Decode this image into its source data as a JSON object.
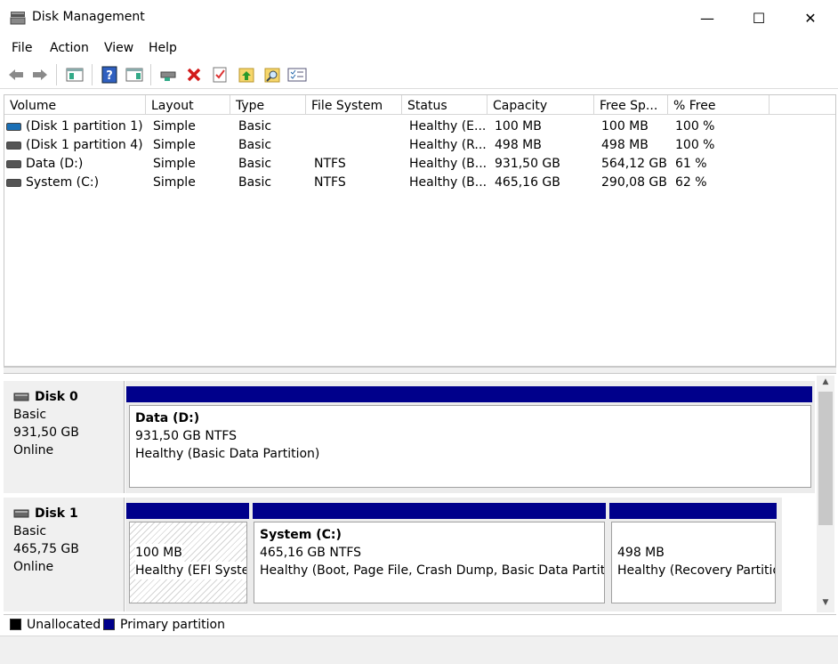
{
  "window": {
    "title": "Disk Management",
    "minimize": "—",
    "maximize": "☐",
    "close": "✕"
  },
  "menu": [
    "File",
    "Action",
    "View",
    "Help"
  ],
  "toolbar": {
    "icons": [
      "back-arrow",
      "forward-arrow",
      "properties",
      "help",
      "console",
      "connect",
      "delete",
      "check",
      "import",
      "search",
      "list"
    ]
  },
  "volume_table": {
    "headers": [
      "Volume",
      "Layout",
      "Type",
      "File System",
      "Status",
      "Capacity",
      "Free Sp...",
      "% Free"
    ],
    "rows": [
      {
        "volume": "(Disk 1 partition 1)",
        "layout": "Simple",
        "type": "Basic",
        "fs": "",
        "status": "Healthy (E...",
        "capacity": "100 MB",
        "free": "100 MB",
        "pct": "100 %",
        "icon_color": "#1a6fb5"
      },
      {
        "volume": "(Disk 1 partition 4)",
        "layout": "Simple",
        "type": "Basic",
        "fs": "",
        "status": "Healthy (R...",
        "capacity": "498 MB",
        "free": "498 MB",
        "pct": "100 %",
        "icon_color": "#555555"
      },
      {
        "volume": "Data (D:)",
        "layout": "Simple",
        "type": "Basic",
        "fs": "NTFS",
        "status": "Healthy (B...",
        "capacity": "931,50 GB",
        "free": "564,12 GB",
        "pct": "61 %",
        "icon_color": "#555555"
      },
      {
        "volume": "System (C:)",
        "layout": "Simple",
        "type": "Basic",
        "fs": "NTFS",
        "status": "Healthy (B...",
        "capacity": "465,16 GB",
        "free": "290,08 GB",
        "pct": "62 %",
        "icon_color": "#555555"
      }
    ]
  },
  "disks": [
    {
      "name": "Disk 0",
      "type": "Basic",
      "size": "931,50 GB",
      "state": "Online",
      "partitions": [
        {
          "title": "Data  (D:)",
          "line1": "931,50 GB NTFS",
          "line2": "Healthy (Basic Data Partition)"
        }
      ]
    },
    {
      "name": "Disk 1",
      "type": "Basic",
      "size": "465,75 GB",
      "state": "Online",
      "partitions": [
        {
          "title": "",
          "line1": "100 MB",
          "line2": "Healthy (EFI System Partition)"
        },
        {
          "title": "System  (C:)",
          "line1": "465,16 GB NTFS",
          "line2": "Healthy (Boot, Page File, Crash Dump, Basic Data Partition)"
        },
        {
          "title": "",
          "line1": "498 MB",
          "line2": "Healthy (Recovery Partition)"
        }
      ]
    }
  ],
  "legend": [
    {
      "label": "Unallocated",
      "color": "#000000"
    },
    {
      "label": "Primary partition",
      "color": "#00008b"
    }
  ],
  "colors": {
    "primary": "#00008b"
  }
}
